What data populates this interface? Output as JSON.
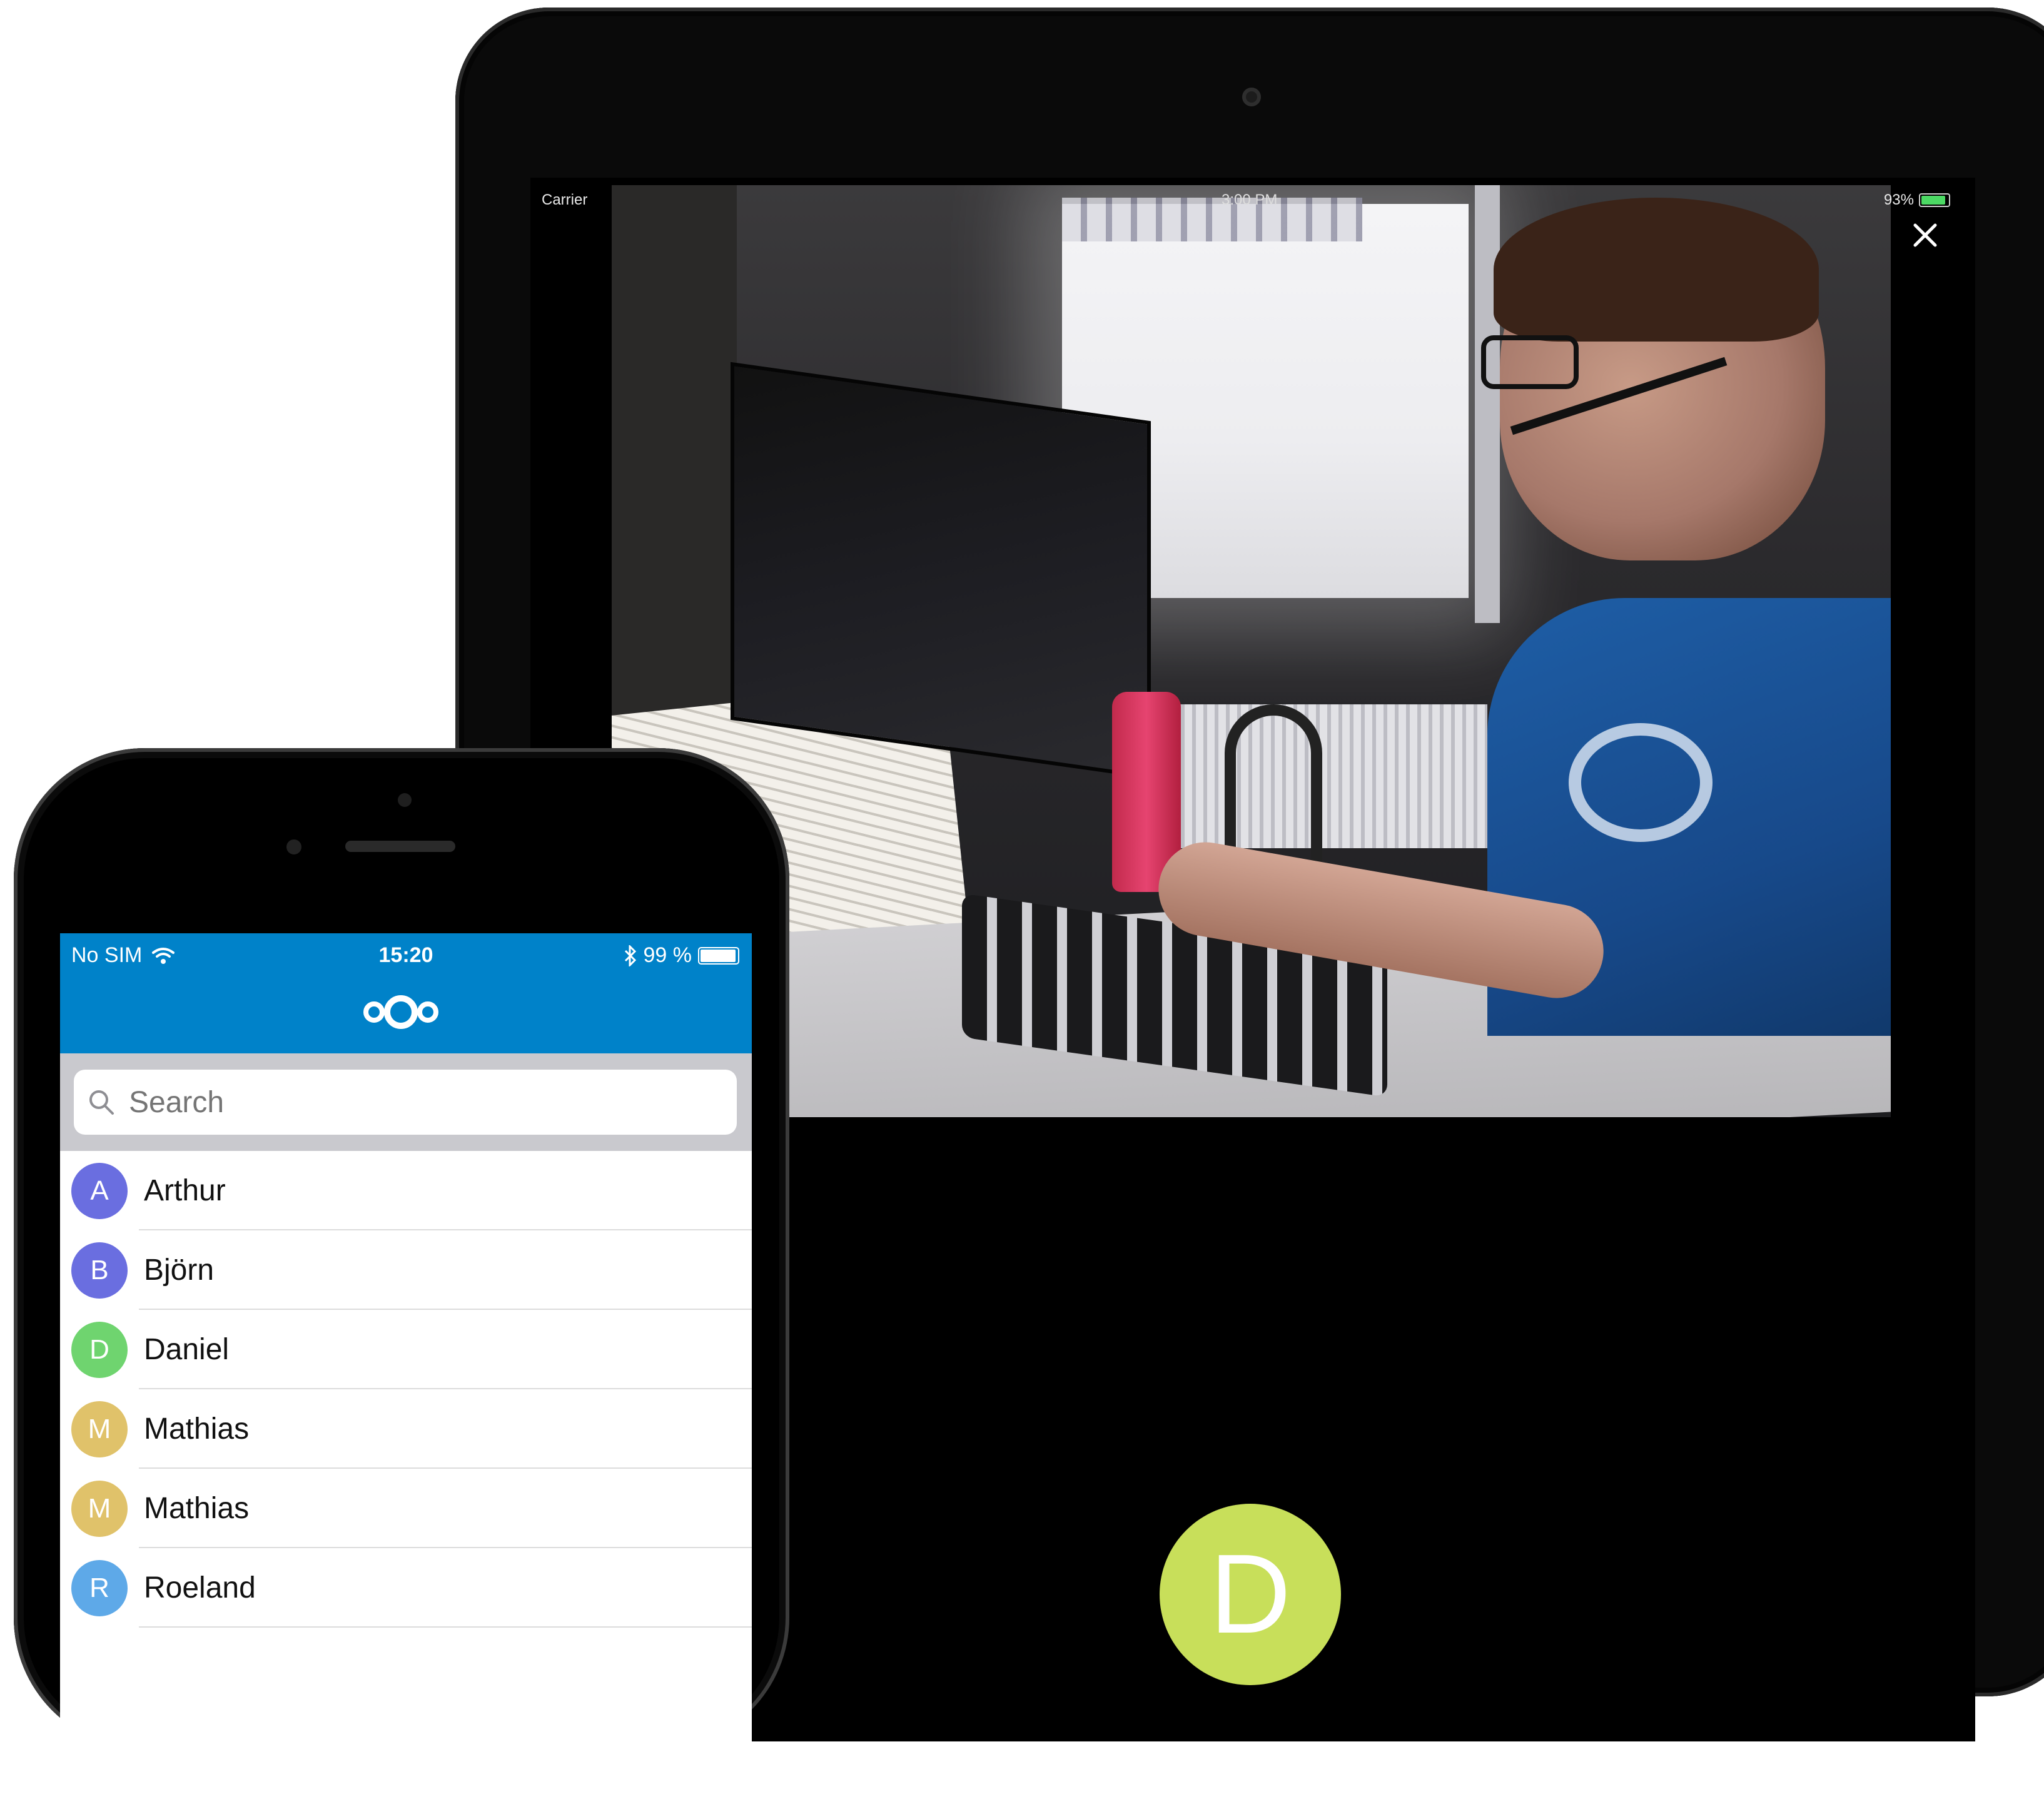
{
  "ipad": {
    "status": {
      "carrier": "Carrier",
      "time": "3:00 PM",
      "battery": "93%"
    },
    "call": {
      "avatar_initial": "D",
      "avatar_color": "#c8df5a"
    }
  },
  "iphone": {
    "status": {
      "carrier": "No SIM",
      "time": "15:20",
      "battery": "99 %"
    },
    "header_color": "#0082c9",
    "search": {
      "placeholder": "Search"
    },
    "contacts": [
      {
        "initial": "A",
        "name": "Arthur",
        "color": "#6a6ee0"
      },
      {
        "initial": "B",
        "name": "Björn",
        "color": "#6a6ee0"
      },
      {
        "initial": "D",
        "name": "Daniel",
        "color": "#6fd46f"
      },
      {
        "initial": "M",
        "name": "Mathias",
        "color": "#e0c26a"
      },
      {
        "initial": "M",
        "name": "Mathias",
        "color": "#e0c26a"
      },
      {
        "initial": "R",
        "name": "Roeland",
        "color": "#5ea9e8"
      }
    ]
  }
}
